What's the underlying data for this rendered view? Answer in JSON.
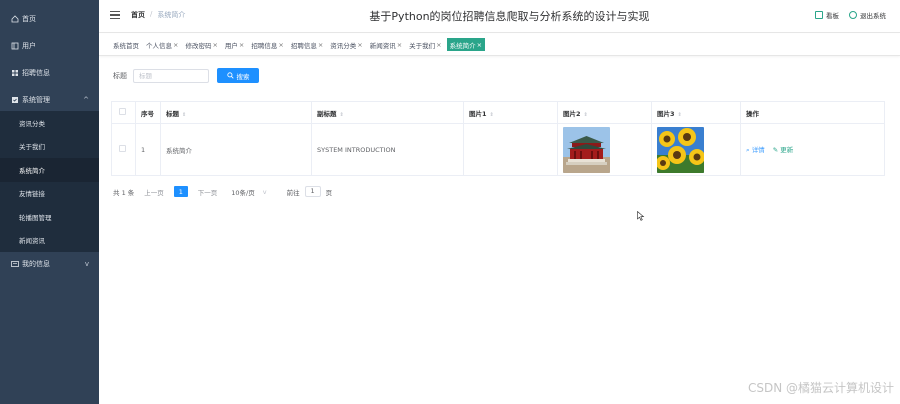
{
  "sidebar": {
    "items": [
      {
        "label": "首页",
        "icon": "home-icon"
      },
      {
        "label": "用户",
        "icon": "user-icon"
      },
      {
        "label": "招聘信息",
        "icon": "grid-icon"
      },
      {
        "label": "系统管理",
        "icon": "settings-box-icon"
      }
    ],
    "system_sub": [
      {
        "label": "资讯分类",
        "active": false
      },
      {
        "label": "关于我们",
        "active": false
      },
      {
        "label": "系统简介",
        "active": true
      },
      {
        "label": "友情链接",
        "active": false
      },
      {
        "label": "轮播图管理",
        "active": false
      },
      {
        "label": "新闻资讯",
        "active": false
      }
    ],
    "last_item": {
      "label": "我的信息",
      "icon": "id-card-icon"
    }
  },
  "header": {
    "breadcrumb_home": "首页",
    "breadcrumb_sep": "/",
    "breadcrumb_current": "系统简介",
    "title": "基于Python的岗位招聘信息爬取与分析系统的设计与实现",
    "right_view": "看板",
    "right_logout": "退出系统"
  },
  "tags": [
    {
      "label": "系统首页",
      "closable": false
    },
    {
      "label": "个人信息",
      "closable": true
    },
    {
      "label": "修改密码",
      "closable": true
    },
    {
      "label": "用户",
      "closable": true
    },
    {
      "label": "招聘信息",
      "closable": true
    },
    {
      "label": "招聘信息",
      "closable": true
    },
    {
      "label": "资讯分类",
      "closable": true
    },
    {
      "label": "新闻资讯",
      "closable": true
    },
    {
      "label": "关于我们",
      "closable": true
    },
    {
      "label": "系统简介",
      "closable": true,
      "active": true
    }
  ],
  "search": {
    "label": "标题",
    "placeholder": "标题",
    "button": "搜索"
  },
  "table": {
    "headers": [
      "序号",
      "标题",
      "副标题",
      "图片1",
      "图片2",
      "图片3",
      "操作"
    ],
    "row": {
      "index": "1",
      "title": "系统简介",
      "subtitle": "SYSTEM INTRODUCTION",
      "pic1": "",
      "detail": "详情",
      "update": "更新"
    }
  },
  "pager": {
    "total": "共 1 条",
    "prev": "上一页",
    "page": "1",
    "next": "下一页",
    "size": "10条/页",
    "goto_prefix": "前往",
    "goto_value": "1",
    "goto_suffix": "页"
  },
  "watermark": "CSDN @橘猫云计算机设计",
  "colors": {
    "sidebar_bg": "#304156",
    "accent_green": "#2aa58a",
    "primary_blue": "#1e90ff"
  }
}
